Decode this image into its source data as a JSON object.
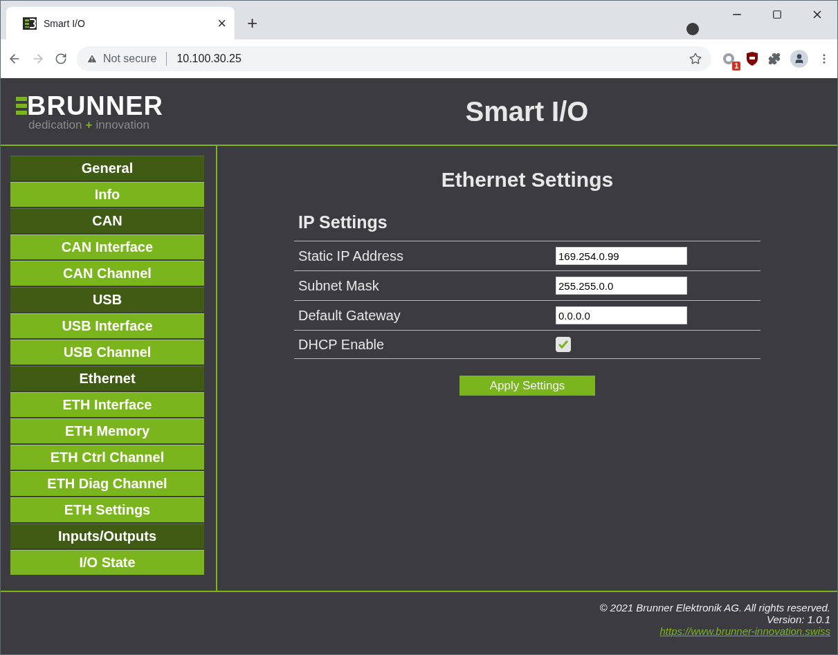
{
  "browser": {
    "tab": {
      "title": "Smart I/O",
      "close": "×",
      "new_tab": "+"
    },
    "address": {
      "security": "Not secure",
      "url": "10.100.30.25"
    },
    "extension_badge": "1"
  },
  "header": {
    "logo": {
      "name": "BRUNNER",
      "tagline": [
        "dedication",
        "+",
        "innovation"
      ]
    },
    "title": "Smart I/O"
  },
  "sidebar": {
    "items": [
      {
        "label": "General",
        "kind": "header"
      },
      {
        "label": "Info",
        "kind": "link"
      },
      {
        "label": "CAN",
        "kind": "header"
      },
      {
        "label": "CAN Interface",
        "kind": "link"
      },
      {
        "label": "CAN Channel",
        "kind": "link"
      },
      {
        "label": "USB",
        "kind": "header"
      },
      {
        "label": "USB Interface",
        "kind": "link"
      },
      {
        "label": "USB Channel",
        "kind": "link"
      },
      {
        "label": "Ethernet",
        "kind": "header"
      },
      {
        "label": "ETH Interface",
        "kind": "link"
      },
      {
        "label": "ETH Memory",
        "kind": "link"
      },
      {
        "label": "ETH Ctrl Channel",
        "kind": "link"
      },
      {
        "label": "ETH Diag Channel",
        "kind": "link"
      },
      {
        "label": "ETH Settings",
        "kind": "link"
      },
      {
        "label": "Inputs/Outputs",
        "kind": "header"
      },
      {
        "label": "I/O State",
        "kind": "link"
      }
    ]
  },
  "content": {
    "title": "Ethernet Settings",
    "section": "IP Settings",
    "fields": [
      {
        "label": "Static IP Address",
        "kind": "text",
        "value": "169.254.0.99"
      },
      {
        "label": "Subnet Mask",
        "kind": "text",
        "value": "255.255.0.0"
      },
      {
        "label": "Default Gateway",
        "kind": "text",
        "value": "0.0.0.0"
      },
      {
        "label": "DHCP Enable",
        "kind": "checkbox",
        "checked": true
      }
    ],
    "button": "Apply Settings"
  },
  "footer": {
    "copyright": "© 2021 Brunner Elektronik AG. All rights reserved.",
    "version": "Version: 1.0.1",
    "link": "https://www.brunner-innovation.swiss"
  }
}
